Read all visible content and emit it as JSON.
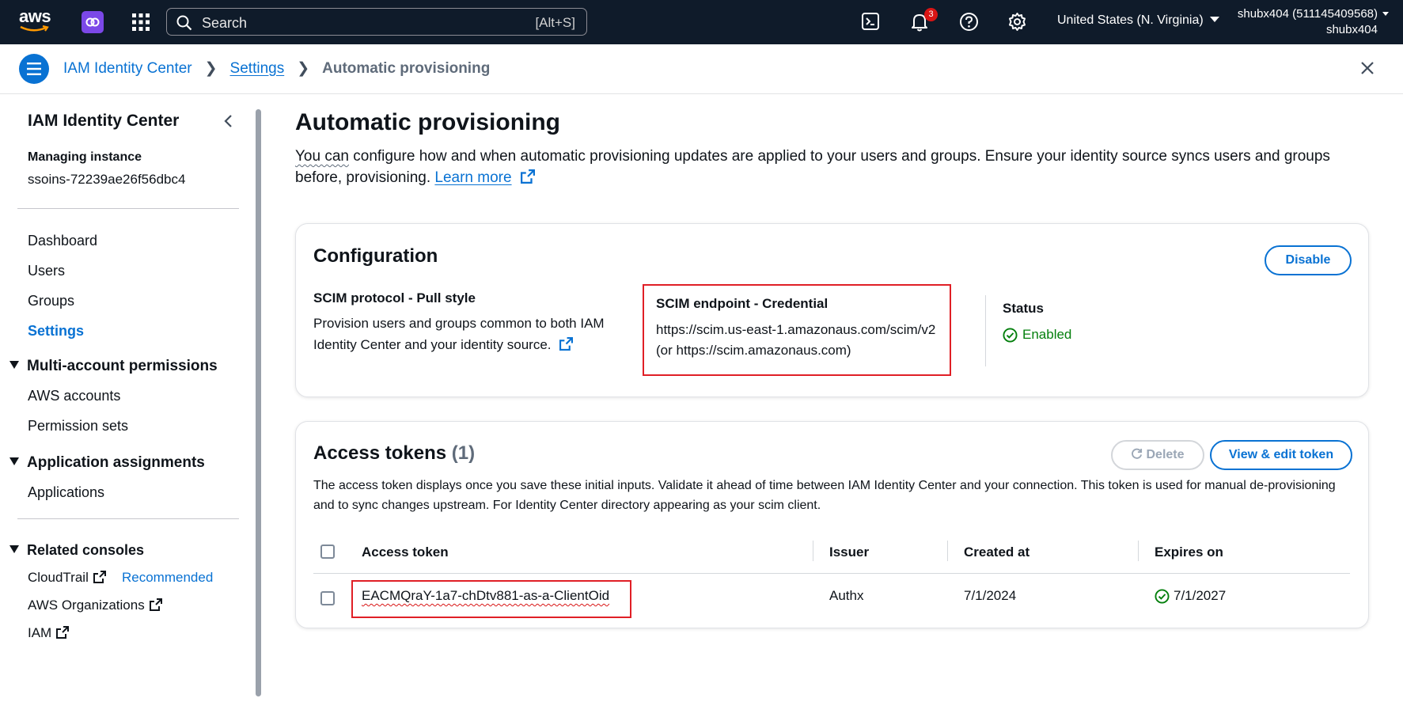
{
  "topbar": {
    "logo": "aws",
    "search_placeholder": "Search",
    "search_shortcut": "[Alt+S]",
    "notification_count": "3",
    "region": "United States (N. Virginia)",
    "account_line1": "shubx404 (511145409568)",
    "account_line2": "shubx404",
    "icons": [
      "app-icon",
      "grid-icon",
      "cloudshell-icon",
      "bell-icon",
      "help-icon",
      "gear-icon"
    ]
  },
  "breadcrumb": {
    "items": [
      "IAM Identity Center",
      "Settings",
      "Automatic provisioning"
    ]
  },
  "sidebar": {
    "title": "IAM Identity Center",
    "managing_label": "Managing instance",
    "managing_value": "ssoins-72239ae26f56dbc4",
    "items": [
      "Dashboard",
      "Users",
      "Groups",
      "Settings"
    ],
    "active_item": "Settings",
    "multi_account": {
      "label": "Multi-account permissions",
      "items": [
        "AWS accounts",
        "Permission sets"
      ]
    },
    "app_assignments": {
      "label": "Application assignments",
      "items": [
        "Applications"
      ]
    },
    "related": {
      "label": "Related consoles",
      "cloudtrail": "CloudTrail",
      "recommended": "Recommended",
      "organizations": "AWS Organizations",
      "iam": "IAM"
    }
  },
  "main": {
    "title": "Automatic provisioning",
    "description_lead": "You can",
    "description": " configure how and when automatic provisioning updates are applied to your users and groups. Ensure your identity source syncs users and groups before, provisioning.",
    "learn_more": "Learn more"
  },
  "configuration": {
    "title": "Configuration",
    "disable_label": "Disable",
    "scim_protocol_label": "SCIM protocol - Pull style",
    "scim_protocol_text": "Provision users and groups common to both IAM Identity Center and your identity source.",
    "endpoint_label": "SCIM endpoint - Credential",
    "endpoint_value": "https://scim.us-east-1.amazonaus.com/scim/v2",
    "endpoint_alt": "(or https://scim.amazonaus.com)",
    "status_label": "Status",
    "status_value": "Enabled",
    "accent_color": "#0972d3",
    "success_color": "#037f0c",
    "highlight_color": "#e01f26"
  },
  "tokens": {
    "title": "Access tokens",
    "count": "(1)",
    "delete_label": "Delete",
    "view_edit_label": "View & edit token",
    "description": "The access token displays once you save these initial inputs. Validate it ahead of time between IAM Identity Center and your connection. This token is used for manual de-provisioning and to sync changes upstream. For Identity Center directory appearing as your scim client.",
    "columns": [
      "Access token",
      "Issuer",
      "Created at",
      "Expires on"
    ],
    "rows": [
      {
        "token": "EACMQraY-1a7-chDtv881-as-a-ClientOid",
        "issuer": "Authx",
        "created": "7/1/2024",
        "expires": "7/1/2027"
      }
    ]
  }
}
